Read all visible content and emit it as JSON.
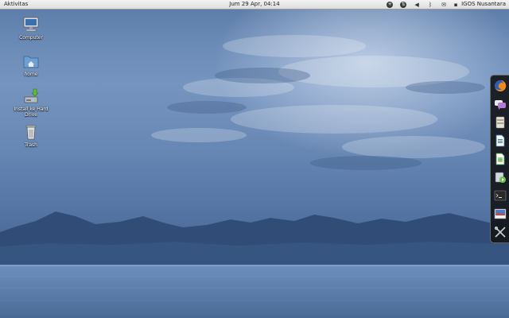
{
  "top_panel": {
    "activities_label": "Aktivitas",
    "clock": "Jum 29 Apr, 04:14",
    "tray_icons": [
      "accessibility-icon",
      "network-icon",
      "volume-icon",
      "bluetooth-icon",
      "messaging-icon"
    ],
    "user_name": "IGOS Nusantara"
  },
  "desktop": {
    "icons": [
      {
        "label": "Computer",
        "icon": "computer-icon"
      },
      {
        "label": "home",
        "icon": "home-folder-icon"
      },
      {
        "label": "Install ke Hard Drive",
        "icon": "install-icon"
      },
      {
        "label": "Trash",
        "icon": "trash-icon"
      }
    ]
  },
  "dash": {
    "apps": [
      "firefox-icon",
      "empathy-chat-icon",
      "file-manager-icon",
      "document-writer-icon",
      "spreadsheet-icon",
      "media-player-icon",
      "terminal-icon",
      "image-viewer-icon",
      "settings-tools-icon"
    ]
  },
  "colors": {
    "panel": "#e6e6e6",
    "dash": "#16181c",
    "sky": "#6b8bb7",
    "sea": "#4b6b97"
  }
}
